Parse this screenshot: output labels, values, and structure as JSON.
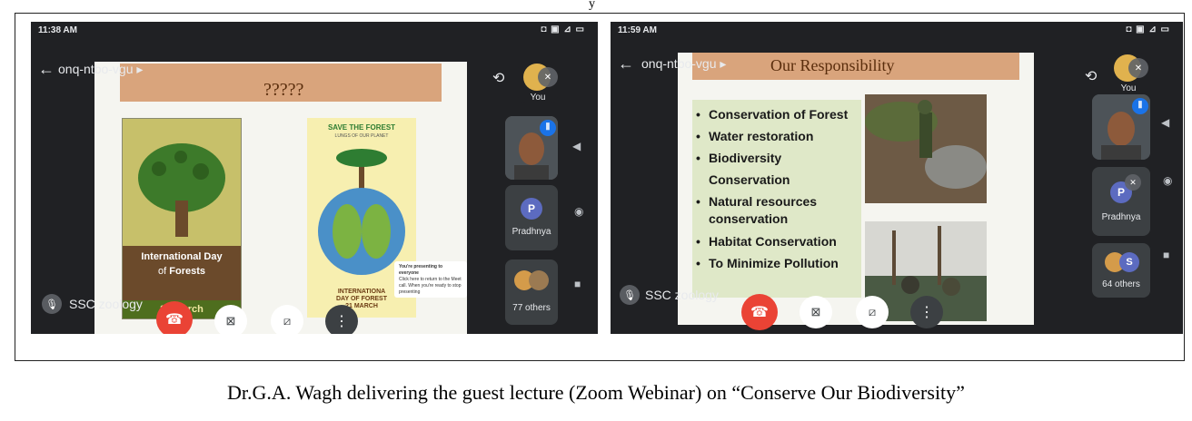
{
  "caption": "Dr.G.A. Wagh delivering the guest lecture (Zoom Webinar) on “Conserve Our Biodiversity”",
  "top_cut_text": "y",
  "shot1": {
    "status_time": "11:38 AM",
    "meeting_code": "onq-ntbo-vgu",
    "slide_title": "?????",
    "poster_left_title": "International Day",
    "poster_left_sub": "of",
    "poster_left_sub_bold": "Forests",
    "poster_left_date": "21 March",
    "poster_right_title": "SAVE THE FOREST",
    "poster_right_sub": "LUNGS OF OUR PLANET",
    "poster_right_bottom1": "INTERNATIONA",
    "poster_right_bottom2": "DAY OF FOREST",
    "poster_right_bottom3": "21 MARCH",
    "you_label": "You",
    "participant_initial": "P",
    "participant_name": "Pradhnya",
    "others_label": "77 others",
    "presenter_name": "SSC zoology",
    "notif_line1": "You're presenting to everyone",
    "notif_line2": "Click here to return to the Meet call. When you're ready to stop presenting"
  },
  "shot2": {
    "status_time": "11:59 AM",
    "meeting_code": "onq-ntbo-vgu",
    "slide_title": "Our Responsibility",
    "bullets": [
      "Conservation of Forest",
      "Water restoration",
      "Biodiversity Conservation",
      "Natural resources conservation",
      "Habitat Conservation",
      "To Minimize Pollution"
    ],
    "you_label": "You",
    "participant_initial": "P",
    "participant_name": "Pradhnya",
    "others_initial": "S",
    "others_label": "64 others",
    "presenter_name": "SSC zoology"
  },
  "colors": {
    "meet_bg": "#202124",
    "end_call": "#ea4335",
    "title_band": "#d9a47c",
    "avatar_blue": "#5c6bc0"
  }
}
